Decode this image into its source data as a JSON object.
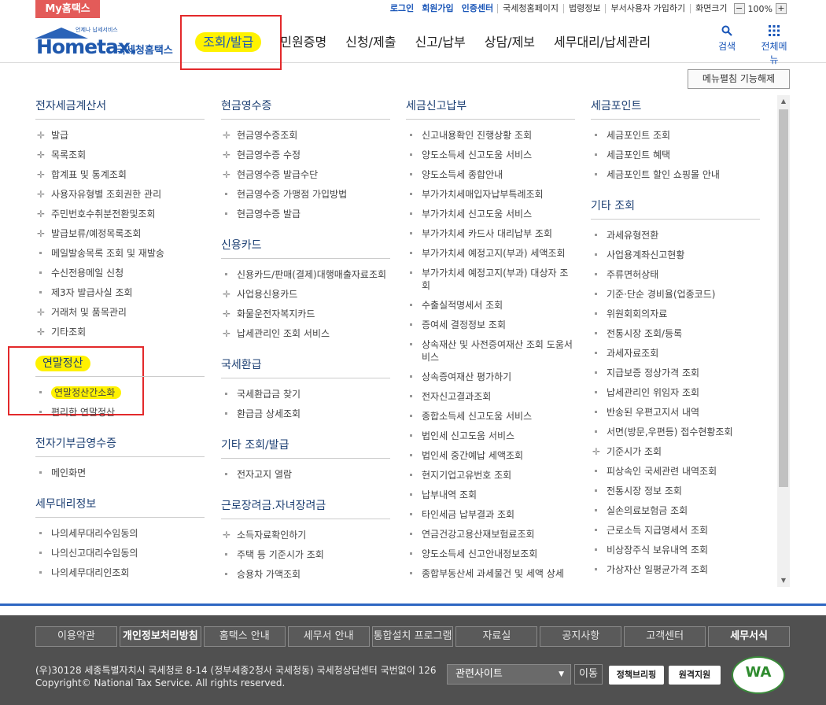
{
  "topbar": {
    "my_tab": "My홈택스",
    "login": "로그인",
    "join": "회원가입",
    "cert": "인증센터",
    "links": [
      "국세청홈페이지",
      "법령정보",
      "부서사용자 가입하기",
      "화면크기"
    ],
    "zoom_minus": "−",
    "zoom_value": "100%",
    "zoom_plus": "+"
  },
  "header": {
    "logo_word": "Hometax.",
    "logo_sub": "언제나 납세서비스",
    "logo_kor": "국세청홈택스",
    "nav": [
      "조회/발급",
      "민원증명",
      "신청/제출",
      "신고/납부",
      "상담/제보",
      "세무대리/납세관리"
    ],
    "search": "검색",
    "allmenu": "전체메뉴"
  },
  "release_button": "메뉴펼침 기능해제",
  "columns": [
    {
      "sections": [
        {
          "title": "전자세금계산서",
          "items": [
            {
              "mk": "plus",
              "t": "발급"
            },
            {
              "mk": "plus",
              "t": "목록조회"
            },
            {
              "mk": "plus",
              "t": "합계표 및 통계조회"
            },
            {
              "mk": "plus",
              "t": "사용자유형별 조회권한 관리"
            },
            {
              "mk": "plus",
              "t": "주민번호수취분전환및조회"
            },
            {
              "mk": "plus",
              "t": "발급보류/예정목록조회"
            },
            {
              "mk": "dot",
              "t": "메일발송목록 조회 및 재발송"
            },
            {
              "mk": "dot",
              "t": "수신전용메일 신청"
            },
            {
              "mk": "dot",
              "t": "제3자 발급사실 조회"
            },
            {
              "mk": "plus",
              "t": "거래처 및 품목관리"
            },
            {
              "mk": "plus",
              "t": "기타조회"
            }
          ]
        },
        {
          "title": "연말정산",
          "highlight": true,
          "items": [
            {
              "mk": "dot",
              "t": "연말정산간소화",
              "highlight": true
            },
            {
              "mk": "dot",
              "t": "편리한 연말정산"
            }
          ]
        },
        {
          "title": "전자기부금영수증",
          "items": [
            {
              "mk": "dot",
              "t": "메인화면"
            }
          ]
        },
        {
          "title": "세무대리정보",
          "items": [
            {
              "mk": "dot",
              "t": "나의세무대리수임동의"
            },
            {
              "mk": "dot",
              "t": "나의신고대리수임동의"
            },
            {
              "mk": "dot",
              "t": "나의세무대리인조회"
            }
          ]
        }
      ]
    },
    {
      "sections": [
        {
          "title": "현금영수증",
          "items": [
            {
              "mk": "plus",
              "t": "현금영수증조회"
            },
            {
              "mk": "plus",
              "t": "현금영수증 수정"
            },
            {
              "mk": "plus",
              "t": "현금영수증 발급수단"
            },
            {
              "mk": "dot",
              "t": "현금영수증 가맹점 가입방법"
            },
            {
              "mk": "dot",
              "t": "현금영수증 발급"
            }
          ]
        },
        {
          "title": "신용카드",
          "items": [
            {
              "mk": "dot",
              "t": "신용카드/판매(결제)대행매출자료조회"
            },
            {
              "mk": "plus",
              "t": "사업용신용카드"
            },
            {
              "mk": "plus",
              "t": "화물운전자복지카드"
            },
            {
              "mk": "plus",
              "t": "납세관리인 조회 서비스"
            }
          ]
        },
        {
          "title": "국세환급",
          "items": [
            {
              "mk": "dot",
              "t": "국세환급금 찾기"
            },
            {
              "mk": "dot",
              "t": "환급금 상세조회"
            }
          ]
        },
        {
          "title": "기타 조회/발급",
          "items": [
            {
              "mk": "dot",
              "t": "전자고지 열람"
            }
          ]
        },
        {
          "title": "근로장려금.자녀장려금",
          "items": [
            {
              "mk": "plus",
              "t": "소득자료확인하기"
            },
            {
              "mk": "dot",
              "t": "주택 등 기준시가 조회"
            },
            {
              "mk": "dot",
              "t": "승용차 가액조회"
            }
          ]
        }
      ]
    },
    {
      "sections": [
        {
          "title": "세금신고납부",
          "items": [
            {
              "mk": "dot",
              "t": "신고내용확인 진행상황 조회"
            },
            {
              "mk": "dot",
              "t": "양도소득세 신고도움 서비스"
            },
            {
              "mk": "dot",
              "t": "양도소득세 종합안내"
            },
            {
              "mk": "dot",
              "t": "부가가치세매입자납부특례조회"
            },
            {
              "mk": "dot",
              "t": "부가가치세 신고도움 서비스"
            },
            {
              "mk": "dot",
              "t": "부가가치세 카드사 대리납부 조회"
            },
            {
              "mk": "dot",
              "t": "부가가치세 예정고지(부과) 세액조회"
            },
            {
              "mk": "dot",
              "t": "부가가치세 예정고지(부과) 대상자 조회"
            },
            {
              "mk": "dot",
              "t": "수출실적명세서 조회"
            },
            {
              "mk": "dot",
              "t": "증여세 결정정보 조회"
            },
            {
              "mk": "dot",
              "t": "상속재산 및 사전증여재산 조회 도움서비스"
            },
            {
              "mk": "dot",
              "t": "상속증여재산 평가하기"
            },
            {
              "mk": "dot",
              "t": "전자신고결과조회"
            },
            {
              "mk": "dot",
              "t": "종합소득세 신고도움 서비스"
            },
            {
              "mk": "dot",
              "t": "법인세 신고도움 서비스"
            },
            {
              "mk": "dot",
              "t": "법인세 중간예납 세액조회"
            },
            {
              "mk": "dot",
              "t": "현지기업고유번호 조회"
            },
            {
              "mk": "dot",
              "t": "납부내역 조회"
            },
            {
              "mk": "dot",
              "t": "타인세금 납부결과 조회"
            },
            {
              "mk": "dot",
              "t": "연금건강고용산재보험료조회"
            },
            {
              "mk": "dot",
              "t": "양도소득세 신고안내정보조회"
            },
            {
              "mk": "dot",
              "t": "종합부동산세 과세물건 및 세액 상세"
            }
          ]
        }
      ]
    },
    {
      "sections": [
        {
          "title": "세금포인트",
          "items": [
            {
              "mk": "dot",
              "t": "세금포인트 조회"
            },
            {
              "mk": "dot",
              "t": "세금포인트 혜택"
            },
            {
              "mk": "dot",
              "t": "세금포인트 할인 쇼핑몰 안내"
            }
          ]
        },
        {
          "title": "기타 조회",
          "items": [
            {
              "mk": "dot",
              "t": "과세유형전환"
            },
            {
              "mk": "dot",
              "t": "사업용계좌신고현황"
            },
            {
              "mk": "dot",
              "t": "주류면허상태"
            },
            {
              "mk": "dot",
              "t": "기준·단순 경비율(업종코드)"
            },
            {
              "mk": "dot",
              "t": "위원회회의자료"
            },
            {
              "mk": "dot",
              "t": "전통시장 조회/등록"
            },
            {
              "mk": "dot",
              "t": "과세자료조회"
            },
            {
              "mk": "dot",
              "t": "지급보증 정상가격 조회"
            },
            {
              "mk": "dot",
              "t": "납세관리인 위임자 조회"
            },
            {
              "mk": "dot",
              "t": "반송된 우편고지서 내역"
            },
            {
              "mk": "dot",
              "t": "서면(방문,우편등) 접수현황조회"
            },
            {
              "mk": "plus",
              "t": "기준시가 조회"
            },
            {
              "mk": "dot",
              "t": "피상속인 국세관련 내역조회"
            },
            {
              "mk": "dot",
              "t": "전통시장 정보 조회"
            },
            {
              "mk": "dot",
              "t": "실손의료보험금 조회"
            },
            {
              "mk": "dot",
              "t": "근로소득 지급명세서 조회"
            },
            {
              "mk": "dot",
              "t": "비상장주식 보유내역 조회"
            },
            {
              "mk": "dot",
              "t": "가상자산 일평균가격 조회"
            }
          ]
        }
      ]
    }
  ],
  "footer": {
    "links": [
      "이용약관",
      "개인정보처리방침",
      "홈택스 안내",
      "세무서 안내",
      "통합설치 프로그램",
      "자료실",
      "공지사항",
      "고객센터",
      "세무서식"
    ],
    "address": "(우)30128 세종특별자치시 국세청로 8-14 (정부세종2청사 국세청동) 국세청상담센터 국번없이 126",
    "copyright": "Copyright© National Tax Service. All rights reserved.",
    "related": "관련사이트",
    "go": "이동",
    "badge1": "정책브리핑",
    "badge2": "원격지원",
    "wa": "WA"
  }
}
